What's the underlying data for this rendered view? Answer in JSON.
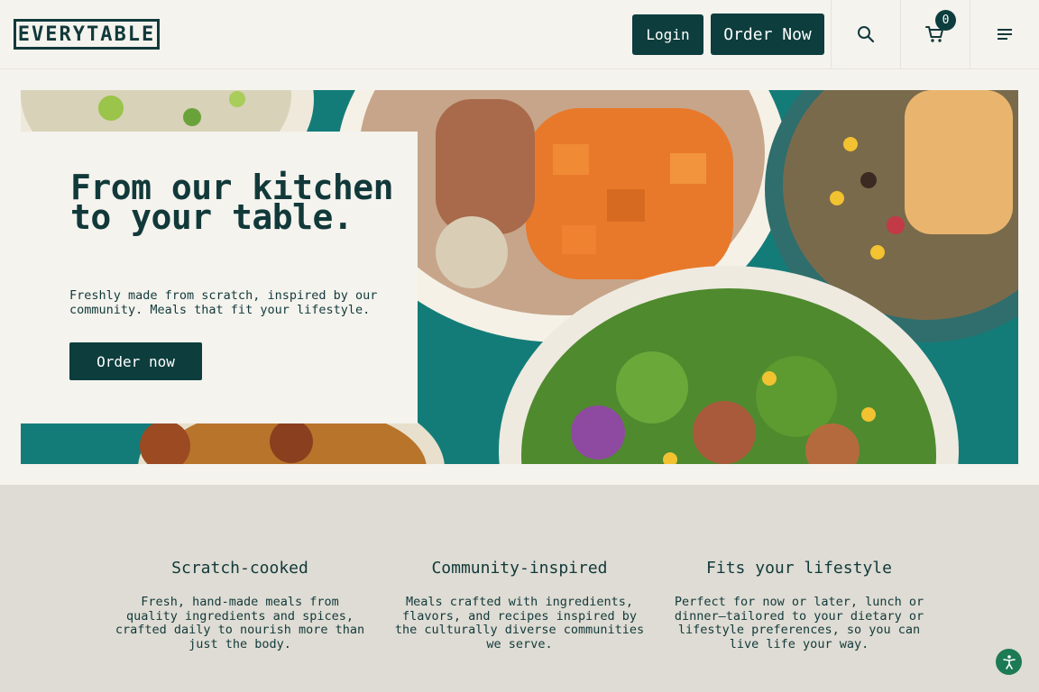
{
  "header": {
    "logo_text": "EVERYTABLE",
    "login_label": "Login",
    "order_now_label": "Order Now",
    "cart_count": "0",
    "icons": [
      "search-icon",
      "cart-icon",
      "menu-icon"
    ]
  },
  "hero": {
    "title": "From our kitchen to your table.",
    "subtitle": "Freshly made from scratch, inspired by our community. Meals that fit your lifestyle.",
    "cta_label": "Order now"
  },
  "features": [
    {
      "title": "Scratch-cooked",
      "body": "Fresh, hand-made meals from quality ingredients and spices, crafted daily to nourish more than just the body."
    },
    {
      "title": "Community-inspired",
      "body": "Meals crafted with ingredients, flavors, and recipes inspired by the culturally diverse communities we serve."
    },
    {
      "title": "Fits your lifestyle",
      "body": "Perfect for now or later, lunch or dinner—tailored to your dietary or lifestyle preferences, so you can live life your way."
    }
  ],
  "colors": {
    "brand": "#0d3d3d",
    "background": "#f4f3ee",
    "features_bg": "#dedcd4",
    "accessibility_button": "#1c7a55"
  }
}
